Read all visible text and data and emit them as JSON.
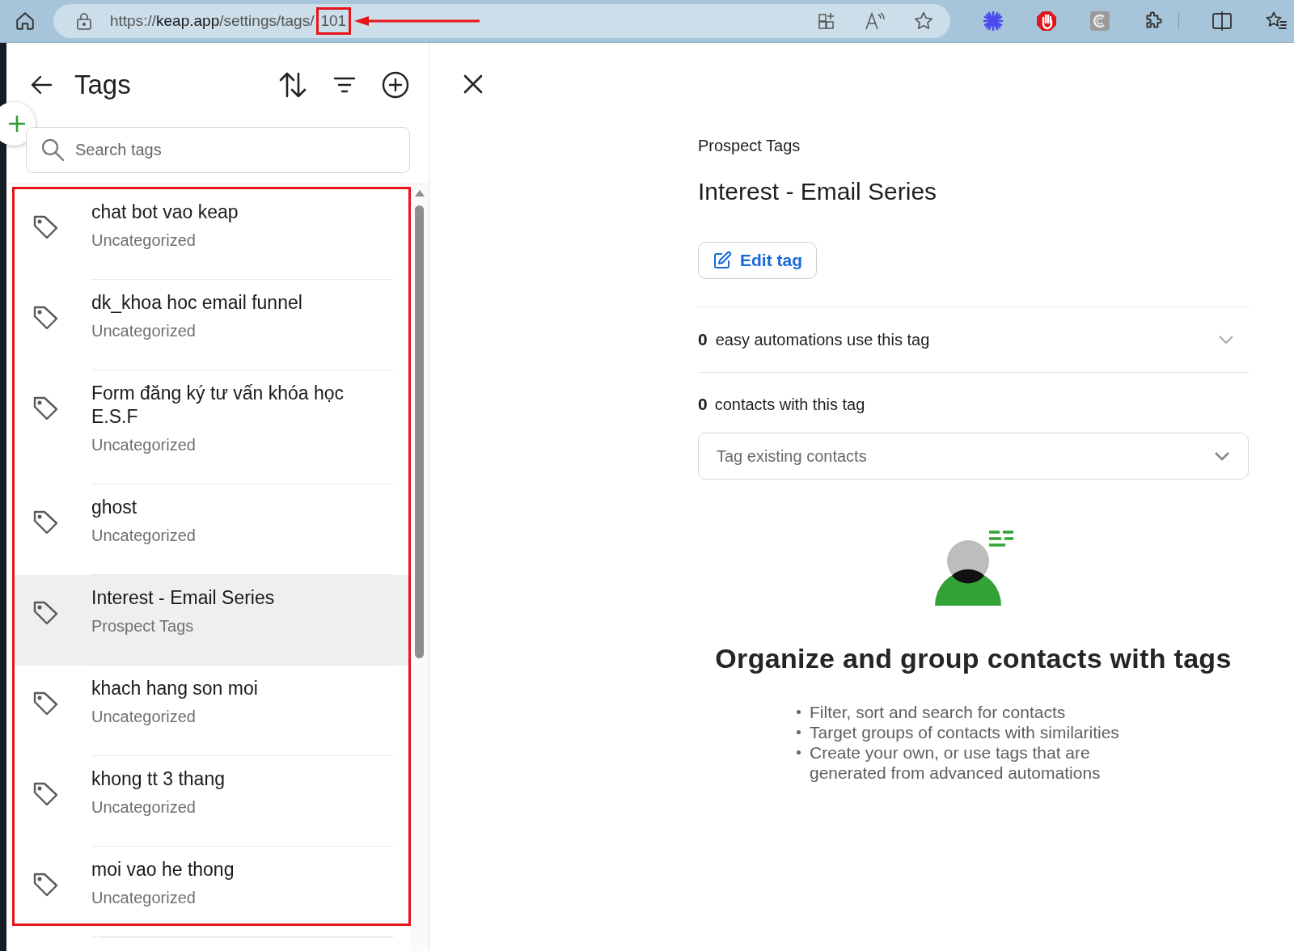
{
  "browser": {
    "url_scheme": "https://",
    "url_host": "keap.app",
    "url_path": "/settings/tags/",
    "url_id": "101",
    "id_highlighted": true
  },
  "tags_panel": {
    "title": "Tags",
    "search": {
      "placeholder": "Search tags"
    },
    "list_highlighted": true,
    "items": [
      {
        "name": "chat bot vao keap",
        "category": "Uncategorized",
        "selected": false
      },
      {
        "name": "dk_khoa hoc email funnel",
        "category": "Uncategorized",
        "selected": false
      },
      {
        "name": "Form đăng ký tư vấn khóa học E.S.F",
        "category": "Uncategorized",
        "selected": false
      },
      {
        "name": "ghost",
        "category": "Uncategorized",
        "selected": false
      },
      {
        "name": "Interest - Email Series",
        "category": "Prospect Tags",
        "selected": true
      },
      {
        "name": "khach hang son moi",
        "category": "Uncategorized",
        "selected": false
      },
      {
        "name": "khong tt 3 thang",
        "category": "Uncategorized",
        "selected": false
      },
      {
        "name": "moi vao he thong",
        "category": "Uncategorized",
        "selected": false
      }
    ]
  },
  "detail": {
    "category": "Prospect Tags",
    "title": "Interest - Email Series",
    "edit_button": "Edit tag",
    "automations": {
      "count": "0",
      "label": "easy automations use this tag",
      "expanded": false
    },
    "contacts": {
      "count": "0",
      "label": "contacts with this tag"
    },
    "tag_contacts": {
      "placeholder": "Tag existing contacts"
    },
    "empty_state": {
      "heading": "Organize and group contacts with tags",
      "bullets": [
        "Filter, sort and search for contacts",
        "Target groups of contacts with similarities",
        "Create your own, or use tags that are generated from advanced automations"
      ]
    }
  }
}
